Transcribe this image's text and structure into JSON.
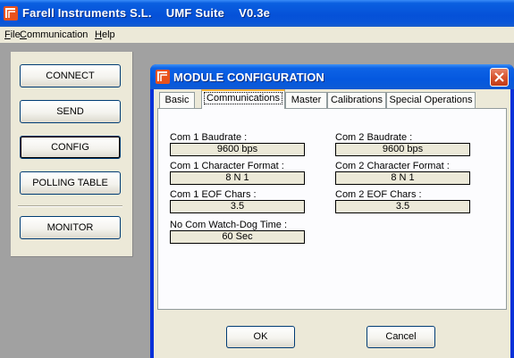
{
  "window": {
    "title_company": "Farell Instruments S.L.",
    "title_app": "UMF Suite",
    "title_version": "V0.3e",
    "icon": "farell-logo-icon"
  },
  "menu": [
    {
      "label": "File",
      "mnemonic": "F"
    },
    {
      "label": "Communication",
      "mnemonic": "C"
    },
    {
      "label": "Help",
      "mnemonic": "H"
    }
  ],
  "sidebar": {
    "buttons": [
      {
        "label": "CONNECT"
      },
      {
        "label": "SEND"
      },
      {
        "label": "CONFIG",
        "active": true
      },
      {
        "label": "POLLING TABLE"
      },
      {
        "label": "MONITOR"
      }
    ]
  },
  "dialog": {
    "title": "MODULE CONFIGURATION",
    "close_icon": "close-icon",
    "tabs": [
      {
        "label": "Basic"
      },
      {
        "label": "Communications",
        "selected": true
      },
      {
        "label": "Master"
      },
      {
        "label": "Calibrations"
      },
      {
        "label": "Special Operations"
      }
    ],
    "fields": {
      "com1_baudrate": {
        "label": "Com 1 Baudrate :",
        "value": "9600 bps"
      },
      "com2_baudrate": {
        "label": "Com 2 Baudrate :",
        "value": "9600 bps"
      },
      "com1_char_format": {
        "label": "Com 1 Character Format :",
        "value": "8 N 1"
      },
      "com2_char_format": {
        "label": "Com 2 Character Format :",
        "value": "8 N 1"
      },
      "com1_eof": {
        "label": "Com 1 EOF Chars :",
        "value": "3.5"
      },
      "com2_eof": {
        "label": "Com 2 EOF Chars :",
        "value": "3.5"
      },
      "watchdog": {
        "label": "No Com Watch-Dog Time :",
        "value": "60 Sec"
      }
    },
    "ok_label": "OK",
    "cancel_label": "Cancel"
  },
  "colors": {
    "titlebar": "#0551d8",
    "client_bg": "#a1a1a1",
    "panel_bg": "#ece9d8",
    "tab_accent": "#f8b33a",
    "close_red": "#d8542e"
  }
}
